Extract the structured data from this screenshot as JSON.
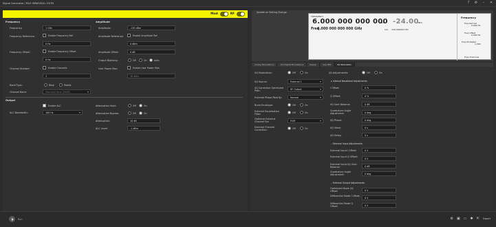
{
  "window": {
    "title": "Signal Generator / R&S SMW200A / EXTN"
  },
  "mod_bar": {
    "title": "Mod",
    "rf_label": "RF"
  },
  "left": {
    "frequency": {
      "title": "Frequency",
      "frequency_label": "Frequency:",
      "frequency_value": "1 GHz",
      "ref_label": "Frequency Reference:",
      "enable_ref": "Enable Frequency Ref.",
      "ref_value": "0 Hz",
      "offset_label": "Frequency Offset:",
      "enable_offset": "Enable Frequency Offset",
      "offset_value": "0 Hz",
      "channel_label": "Channel Number:",
      "enable_channels": "Enable Channels",
      "channel_value": "1",
      "band_label": "Band Type:",
      "band_opt1": "Base",
      "band_opt2": "Mobile",
      "channel_band_label": "Channel Band:",
      "channel_band_value": "Standard Base (BASE)"
    },
    "amplitude": {
      "title": "Amplitude",
      "amplitude_label": "Amplitude:",
      "amplitude_value": "-130 dBm",
      "ref_label": "Amplitude Reference:",
      "enable_ref": "Enable Amplitude Ref.",
      "ref_value": "0 dBm",
      "offset_label": "Amplitude Offset:",
      "offset_value": "0 dB",
      "output_label": "Output Blanking:",
      "output_opt1": "Off",
      "output_opt2": "On",
      "output_opt3": "Auto",
      "user_power_label": "User Power Max:",
      "enable_user_power": "Enable User Power Max",
      "user_power_value": "30 dBm"
    },
    "output": {
      "title": "Output",
      "enable_alc": "Enable ALC",
      "alc_bw_label": "ALC Bandwidth:",
      "alc_bw_value": "100 Hz",
      "att_hold_label": "Attenuation Hold:",
      "att_bypass_label": "Attenuation Bypass:",
      "attenuation_label": "Attenuation:",
      "attenuation_value": "10 dB",
      "alc_level_label": "ALC Level:",
      "alc_level_value": "-1 dBm",
      "off": "Off",
      "on": "On"
    }
  },
  "right": {
    "note": "Update on Setting Change",
    "display": {
      "freq_label": "FREQUENCY",
      "freq_big": "6.000 000 000 000",
      "freq_unit": "GHz",
      "amp_big": "-24.00",
      "amp_unit": "dBm",
      "freq_small_label": "Freq",
      "freq_small": "6.000 000 000 000 GHz",
      "incr_label": "Incr",
      "incr_value": "100.000000 kHz",
      "side_title": "Frequency",
      "side1": "Freq Ref Set",
      "side1v": "0.000 Hz",
      "side2": "Freq Offset",
      "side2v": "0.000 Hz",
      "side3": "Freq Multiplier",
      "side3v": "1.000",
      "side4": "Freq Channels"
    },
    "tabs": [
      "Analog Modulations",
      "Arb Digital Modulations",
      "Sweep",
      "User BW",
      "I/Q Modulation"
    ],
    "iq": {
      "iq_mod_label": "I/Q Modulation:",
      "iq_source_label": "I/Q Source:",
      "iq_source_value": "External 1",
      "iq_corr_label": "I/Q Correction Optimized Path:",
      "iq_corr_value": "RF Output",
      "ext_phase_label": "External Phase Polarity:",
      "ext_phase_value": "Normal",
      "burst_label": "Burst Envelope:",
      "ext_eq_label": "External Equalization Filter:",
      "opt_ext_label": "Optimize External Channel For:",
      "opt_ext_value": "EVM",
      "ext_corr_label": "External Channel Correction:",
      "iq_adj_label": "I/Q Adjustments:",
      "int_base_title": "Internal Baseband Adjustments",
      "i_offset_label": "I Offset:",
      "i_offset": "0 %",
      "q_offset_label": "Q Offset:",
      "q_offset": "0 %",
      "iq_gain_label": "I/Q Gain Balance:",
      "iq_gain": "0 dB",
      "quad_label": "Quadrature Angle Adjustment:",
      "quad": "0 deg",
      "iq_phase_label": "I/Q Phase:",
      "iq_phase": "0 deg",
      "iq_skew_label": "I/Q Skew:",
      "iq_skew": "0 s",
      "iq_delay_label": "I/Q Delay:",
      "iq_delay": "0 s",
      "ext_input_title": "External Input Adjustments",
      "ext_i_label": "External Input I Offset:",
      "ext_i": "0 V",
      "ext_q_label": "External Input Q Offset:",
      "ext_q": "0 V",
      "ext_gain_label": "External Input I/Q Gain Balance:",
      "ext_gain": "0 dB",
      "ext_quad_label": "Quadrature Angle Adjustment:",
      "ext_quad": "0 deg",
      "ext_out_title": "External Output Adjustments",
      "out_mode_label": "Optimized Mode I/Q Offset:",
      "out_mode": "0 V",
      "diff_i_label": "Differential Mode I Offset:",
      "diff_i": "0 V",
      "diff_q_label": "Differential Mode Q Offset:",
      "diff_q": "0 V",
      "off": "Off",
      "on": "On"
    }
  },
  "status": {
    "run_label": "Run",
    "export_label": "Export"
  }
}
